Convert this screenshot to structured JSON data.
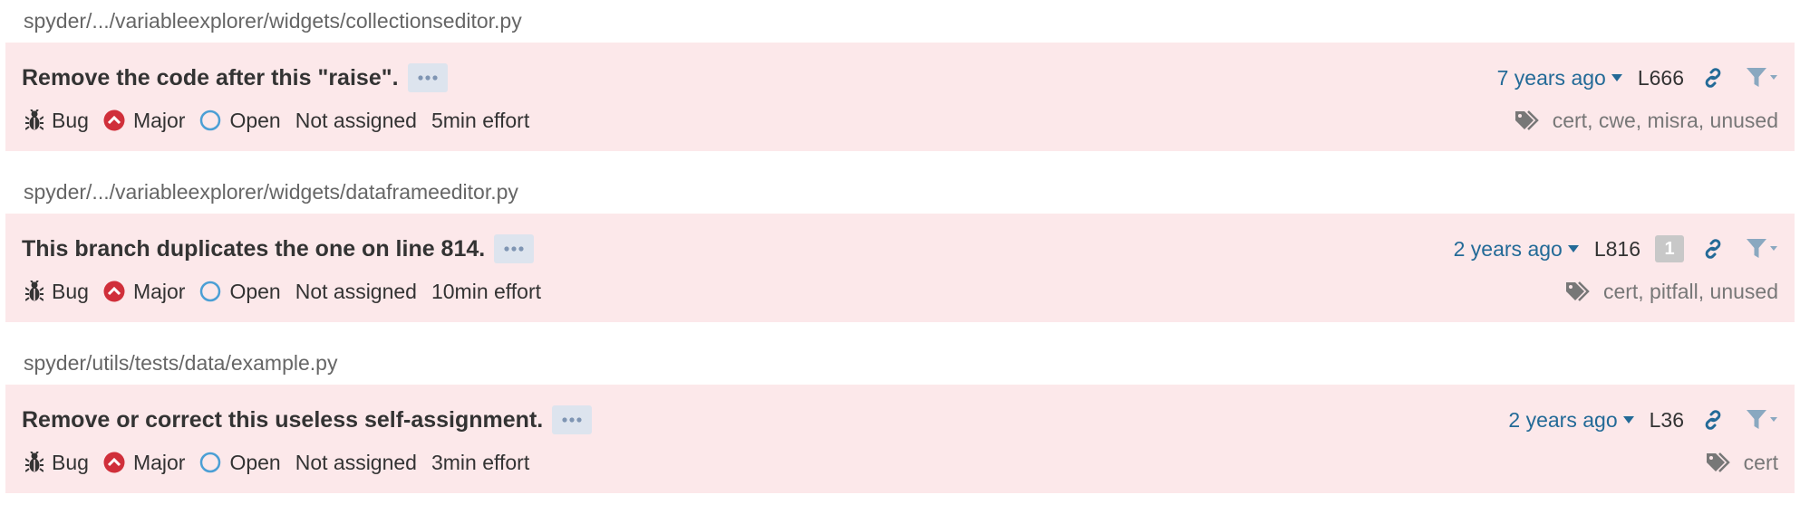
{
  "issues": [
    {
      "file": "spyder/.../variableexplorer/widgets/collectionseditor.py",
      "message": "Remove the code after this \"raise\".",
      "date": "7 years ago",
      "line": "L666",
      "count": "",
      "type": "Bug",
      "severity": "Major",
      "status": "Open",
      "assignee": "Not assigned",
      "effort": "5min effort",
      "tags": "cert, cwe, misra, unused"
    },
    {
      "file": "spyder/.../variableexplorer/widgets/dataframeeditor.py",
      "message": "This branch duplicates the one on line 814.",
      "date": "2 years ago",
      "line": "L816",
      "count": "1",
      "type": "Bug",
      "severity": "Major",
      "status": "Open",
      "assignee": "Not assigned",
      "effort": "10min effort",
      "tags": "cert, pitfall, unused"
    },
    {
      "file": "spyder/utils/tests/data/example.py",
      "message": "Remove or correct this useless self-assignment.",
      "date": "2 years ago",
      "line": "L36",
      "count": "",
      "type": "Bug",
      "severity": "Major",
      "status": "Open",
      "assignee": "Not assigned",
      "effort": "3min effort",
      "tags": "cert"
    }
  ],
  "icons": {
    "type": "bug-icon",
    "severity": "major-severity-icon",
    "status": "open-status-icon",
    "more": "more-icon",
    "link": "link-icon",
    "filter": "filter-icon",
    "tags": "tag-icon",
    "caret": "chevron-down-icon"
  },
  "colors": {
    "issue_background": "#fce8ea",
    "link": "#236a97",
    "severity_major": "#d02f3a",
    "status_open": "#4b9fd5"
  }
}
